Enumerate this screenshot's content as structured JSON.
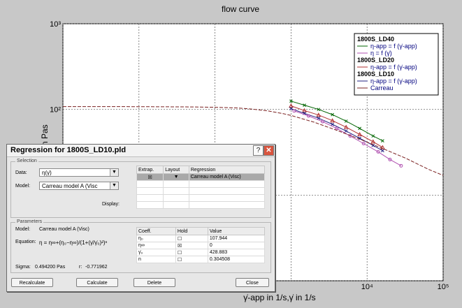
{
  "chart_data": {
    "type": "line",
    "title": "flow curve",
    "xlabel": "γ̇-app in 1/s,γ̇ in 1/s",
    "ylabel": "η in Pas",
    "x_scale": "log",
    "y_scale": "log",
    "xlim": [
      1,
      100000
    ],
    "ylim": [
      1,
      1000
    ],
    "x_ticks": [
      {
        "value": 10000,
        "label": "10⁴"
      },
      {
        "value": 100000,
        "label": "10⁵"
      }
    ],
    "y_ticks": [
      {
        "value": 1000,
        "label": "10³"
      },
      {
        "value": 100,
        "label": "10²"
      }
    ],
    "grid": true,
    "legend_position": "top-right",
    "series": [
      {
        "name": "1800S_LD40  η-app = f (γ̇-app)",
        "color": "#006400",
        "marker": "cross",
        "x": [
          1000,
          1500,
          2300,
          3500,
          5300,
          8000,
          12000,
          16000
        ],
        "y": [
          125,
          112,
          100,
          87,
          73,
          60,
          49,
          43
        ]
      },
      {
        "name": "1800S_LD20  η-app = f (γ̇-app)",
        "color": "#b03030",
        "marker": "triangle",
        "x": [
          1000,
          1500,
          2300,
          3500,
          5300,
          8000,
          12000,
          16000
        ],
        "y": [
          110,
          97,
          86,
          74,
          62,
          51,
          42,
          36
        ]
      },
      {
        "name": "1800S_LD10  η-app = f (γ̇-app)",
        "color": "#202080",
        "marker": "cross",
        "x": [
          1000,
          1500,
          2300,
          3500,
          5300,
          8000,
          12000,
          16000
        ],
        "y": [
          102,
          90,
          79,
          67,
          56,
          46,
          38,
          33
        ]
      },
      {
        "name": "η = f (γ̇)",
        "color": "#b050b0",
        "marker": "circle",
        "x": [
          1100,
          1700,
          2600,
          4000,
          6000,
          9000,
          14000,
          20000,
          28000
        ],
        "y": [
          96,
          84,
          72,
          60,
          49,
          40,
          32,
          26,
          22
        ]
      },
      {
        "name": "Carreau",
        "color": "#7a2020",
        "marker": "none",
        "x": [
          1,
          10,
          50,
          100,
          200,
          300,
          500,
          800,
          1000,
          2000,
          4000,
          8000,
          16000,
          32000,
          64000,
          100000
        ],
        "y": [
          107.9,
          107.8,
          107,
          106,
          104,
          101,
          96,
          89,
          85,
          71,
          57,
          45,
          35,
          27,
          20,
          17
        ]
      }
    ]
  },
  "legend": {
    "groups": [
      {
        "title": "1800S_LD40",
        "entries": [
          {
            "label": "η-app = f (γ̇-app)",
            "color": "#006400"
          },
          {
            "label": "η = f (γ̇)",
            "color": "#b050b0"
          }
        ]
      },
      {
        "title": "1800S_LD20",
        "entries": [
          {
            "label": "η-app = f (γ̇-app)",
            "color": "#b03030"
          }
        ]
      },
      {
        "title": "1800S_LD10",
        "entries": [
          {
            "label": "η-app = f (γ̇-app)",
            "color": "#202080"
          },
          {
            "label": "Carreau",
            "color": "#7a2020"
          }
        ]
      }
    ]
  },
  "dialog": {
    "title": "Regression for 1800S_LD10.pld",
    "help": "?",
    "close": "✕",
    "selection": {
      "group_label": "Selection",
      "data_label": "Data:",
      "data_value": "η(γ̇)",
      "model_label": "Model:",
      "model_value": "Carreau model A (Visc",
      "display_label": "Display:",
      "columns": [
        "Extrap.",
        "Layout",
        "Regression"
      ],
      "rows": [
        {
          "extrap": "☒",
          "layout": "▼",
          "regression": "Carreau model A (Visc)"
        }
      ]
    },
    "parameters": {
      "group_label": "Parameters",
      "model_label": "Model:",
      "model_value": "Carreau model A (Visc)",
      "equation_label": "Equation:",
      "equation": "η = η∞+(η₀−η∞)/(1+(γ̇/γ̇₀)²)ⁿ",
      "sigma_label": "Sigma:",
      "sigma_value": "0.494200 Pas",
      "r_label": "r:",
      "r_value": "-0.771962",
      "columns": [
        "Coeff.",
        "Hold",
        "Value"
      ],
      "rows": [
        {
          "coeff": "η₀",
          "hold": "☐",
          "value": "107.944"
        },
        {
          "coeff": "η∞",
          "hold": "☒",
          "value": "0"
        },
        {
          "coeff": "γ̇₀",
          "hold": "☐",
          "value": "428.883"
        },
        {
          "coeff": "n",
          "hold": "☐",
          "value": "0.304508"
        }
      ]
    },
    "buttons": {
      "recalculate": "Recalculate",
      "calculate": "Calculate",
      "delete": "Delete",
      "close": "Close"
    }
  }
}
